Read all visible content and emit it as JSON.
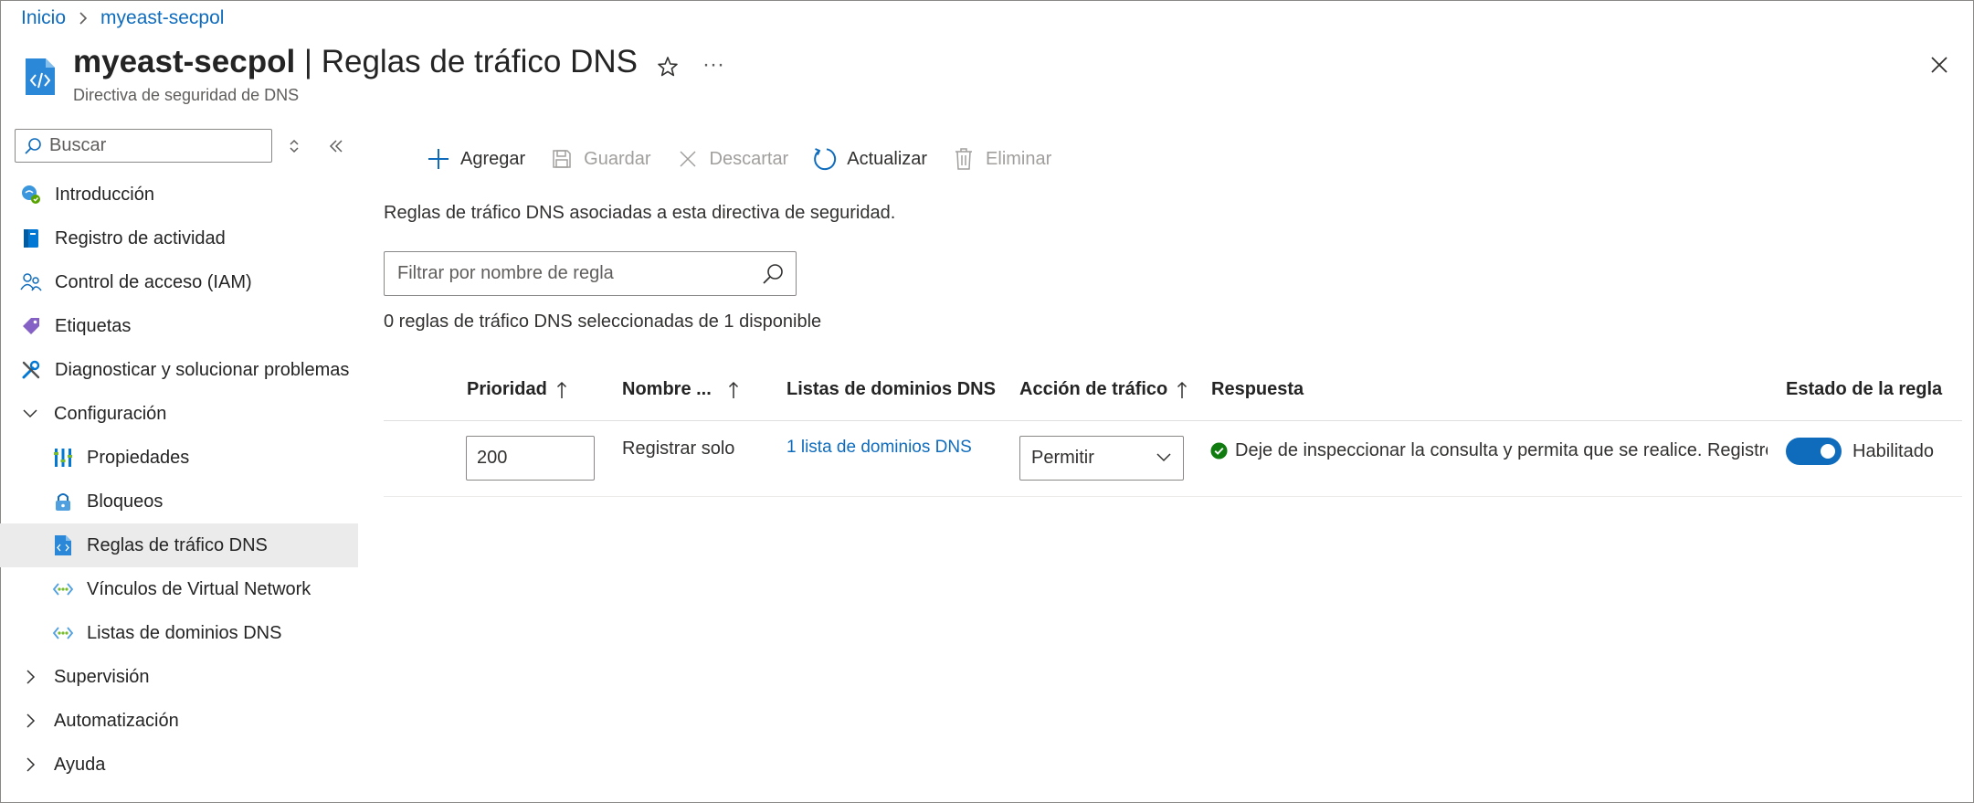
{
  "breadcrumb": [
    {
      "label": "Inicio"
    },
    {
      "label": "myeast-secpol"
    }
  ],
  "header": {
    "resource_name": "myeast-secpol",
    "title_suffix": " | Reglas de tráfico DNS",
    "subtitle": "Directiva de seguridad de DNS",
    "more_label": "···"
  },
  "sidebar": {
    "search_placeholder": "Buscar",
    "items": [
      {
        "label": "Introducción",
        "icon": "overview-icon"
      },
      {
        "label": "Registro de actividad",
        "icon": "activity-log-icon"
      },
      {
        "label": "Control de acceso (IAM)",
        "icon": "iam-icon"
      },
      {
        "label": "Etiquetas",
        "icon": "tag-icon"
      },
      {
        "label": "Diagnosticar y solucionar problemas",
        "icon": "wrench-icon"
      },
      {
        "label": "Configuración",
        "icon": "chevron-down-icon",
        "expanded": true
      },
      {
        "label": "Propiedades",
        "icon": "properties-icon"
      },
      {
        "label": "Bloqueos",
        "icon": "lock-icon"
      },
      {
        "label": "Reglas de tráfico DNS",
        "icon": "dns-policy-icon",
        "active": true
      },
      {
        "label": "Vínculos de Virtual Network",
        "icon": "vnet-link-icon"
      },
      {
        "label": "Listas de dominios DNS",
        "icon": "domain-list-icon"
      },
      {
        "label": "Supervisión",
        "icon": "chevron-right-icon"
      },
      {
        "label": "Automatización",
        "icon": "chevron-right-icon"
      },
      {
        "label": "Ayuda",
        "icon": "chevron-right-icon"
      }
    ]
  },
  "toolbar": {
    "add": "Agregar",
    "save": "Guardar",
    "discard": "Descartar",
    "refresh": "Actualizar",
    "delete": "Eliminar"
  },
  "main": {
    "description": "Reglas de tráfico DNS asociadas a esta directiva de seguridad.",
    "filter_placeholder": "Filtrar por nombre de regla",
    "selection_count": "0 reglas de tráfico DNS seleccionadas de 1 disponible"
  },
  "table": {
    "columns": [
      "Prioridad",
      "Nombre ...",
      "Listas de dominios DNS",
      "Acción de tráfico",
      "Respuesta",
      "Estado de la regla"
    ],
    "rows": [
      {
        "priority": "200",
        "name": "Registrar solo",
        "domain_lists": "1 lista de dominios DNS",
        "action": "Permitir",
        "response": "Deje de inspeccionar la consulta y permita que se realice. Registre la",
        "state": "Habilitado"
      }
    ]
  },
  "colors": {
    "accent": "#0f6cbd",
    "success": "#107c10",
    "active_nav": "#ebebeb"
  }
}
